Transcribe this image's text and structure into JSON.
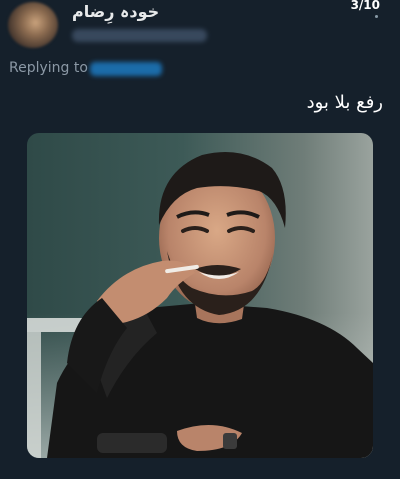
{
  "tweet": {
    "display_name": "خودہ رِضام",
    "counter": "3/10",
    "replying_to_label": "Replying to",
    "text": "رفع بلا بود"
  },
  "colors": {
    "background": "#15202b",
    "muted_text": "#8b98a5",
    "link_blue": "#1d9bf0"
  },
  "icons": {
    "avatar": "profile-avatar-blurred"
  }
}
